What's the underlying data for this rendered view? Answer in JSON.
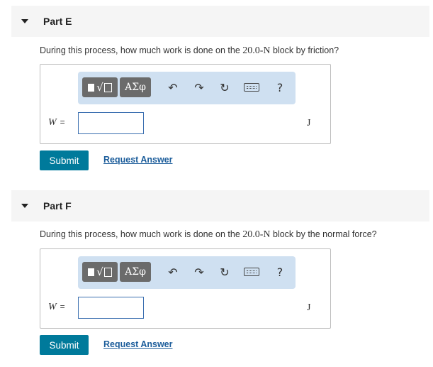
{
  "parts": [
    {
      "title": "Part E",
      "question_pre": "During this process, how much work is done on the ",
      "question_value": "20.0-N",
      "question_post": " block by friction?",
      "variable": "W",
      "equals": "=",
      "input_value": "",
      "unit": "J",
      "submit_label": "Submit",
      "request_label": "Request Answer"
    },
    {
      "title": "Part F",
      "question_pre": "During this process, how much work is done on the ",
      "question_value": "20.0-N",
      "question_post": " block by the normal force?",
      "variable": "W",
      "equals": "=",
      "input_value": "",
      "unit": "J",
      "submit_label": "Submit",
      "request_label": "Request Answer"
    }
  ],
  "toolbar": {
    "greek_label": "ΑΣφ",
    "undo_glyph": "↶",
    "redo_glyph": "↷",
    "reset_glyph": "↻",
    "help_glyph": "?",
    "icons": [
      "templates-icon",
      "greek-letters-icon",
      "undo-icon",
      "redo-icon",
      "reset-icon",
      "keyboard-icon",
      "help-icon"
    ]
  },
  "colors": {
    "header_bg": "#f5f5f5",
    "toolbar_bg": "#cfe0f1",
    "toolbar_button": "#6b6b6b",
    "submit_bg": "#007a9b",
    "link": "#1c5d9b",
    "input_border": "#3b6fb0"
  }
}
